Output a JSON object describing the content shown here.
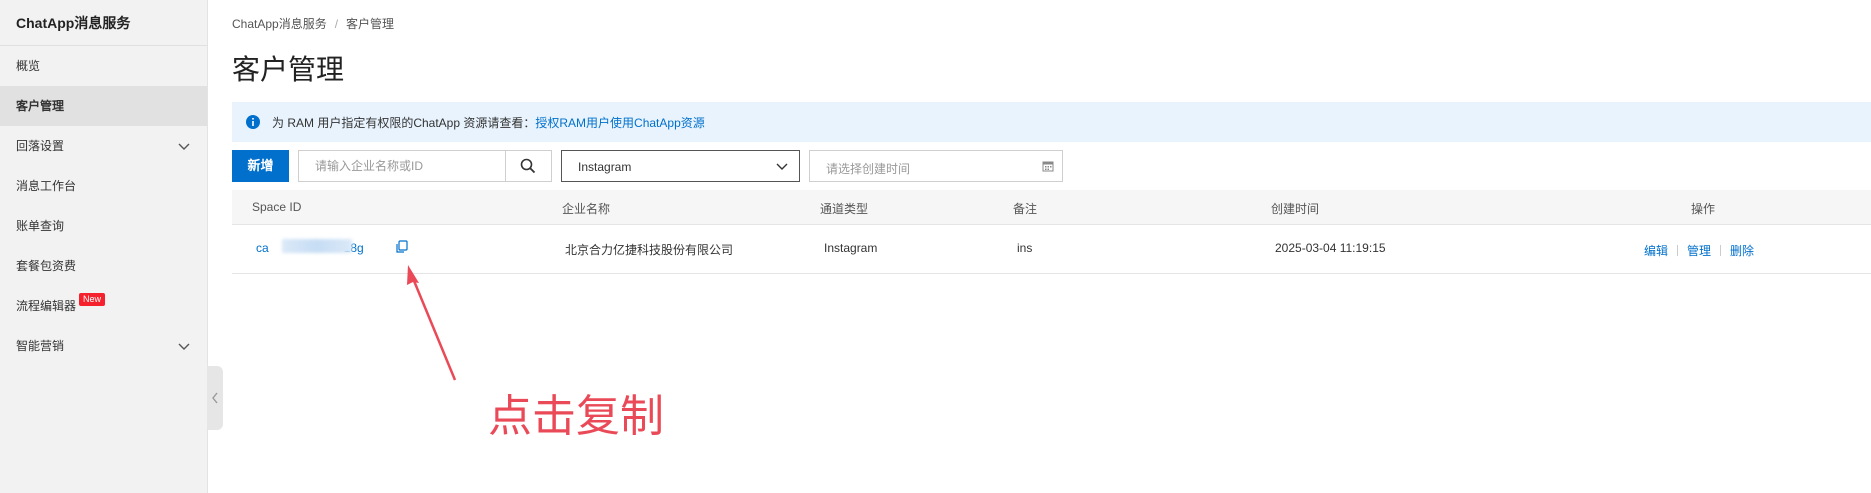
{
  "sidebar": {
    "title": "ChatApp消息服务",
    "items": [
      {
        "label": "概览"
      },
      {
        "label": "客户管理"
      },
      {
        "label": "回落设置"
      },
      {
        "label": "消息工作台"
      },
      {
        "label": "账单查询"
      },
      {
        "label": "套餐包资费"
      },
      {
        "label": "流程编辑器",
        "badge": "New"
      },
      {
        "label": "智能营销"
      }
    ]
  },
  "breadcrumb": [
    "ChatApp消息服务",
    "/",
    "客户管理"
  ],
  "page_title": "客户管理",
  "notice": {
    "text": "为 RAM 用户指定有权限的ChatApp 资源请查看：",
    "link": "授权RAM用户使用ChatApp资源"
  },
  "toolbar": {
    "add_label": "新增",
    "search_placeholder": "请输入企业名称或ID",
    "channel_value": "Instagram",
    "date_placeholder": "请选择创建时间"
  },
  "table": {
    "headers": [
      "Space ID",
      "企业名称",
      "通道类型",
      "备注",
      "创建时间",
      "操作"
    ],
    "rows": [
      {
        "space_id_start": "ca",
        "space_id_end": "18g",
        "company": "北京合力亿捷科技股份有限公司",
        "channel": "Instagram",
        "note": "ins",
        "created": "2025-03-04 11:19:15",
        "actions": [
          "编辑",
          "管理",
          "删除"
        ]
      }
    ]
  },
  "annotation": "点击复制",
  "colors": {
    "primary": "#0070cc",
    "annotation": "#ea4a57",
    "badge": "#f5222d",
    "notice_bg": "#e8f3fd"
  }
}
